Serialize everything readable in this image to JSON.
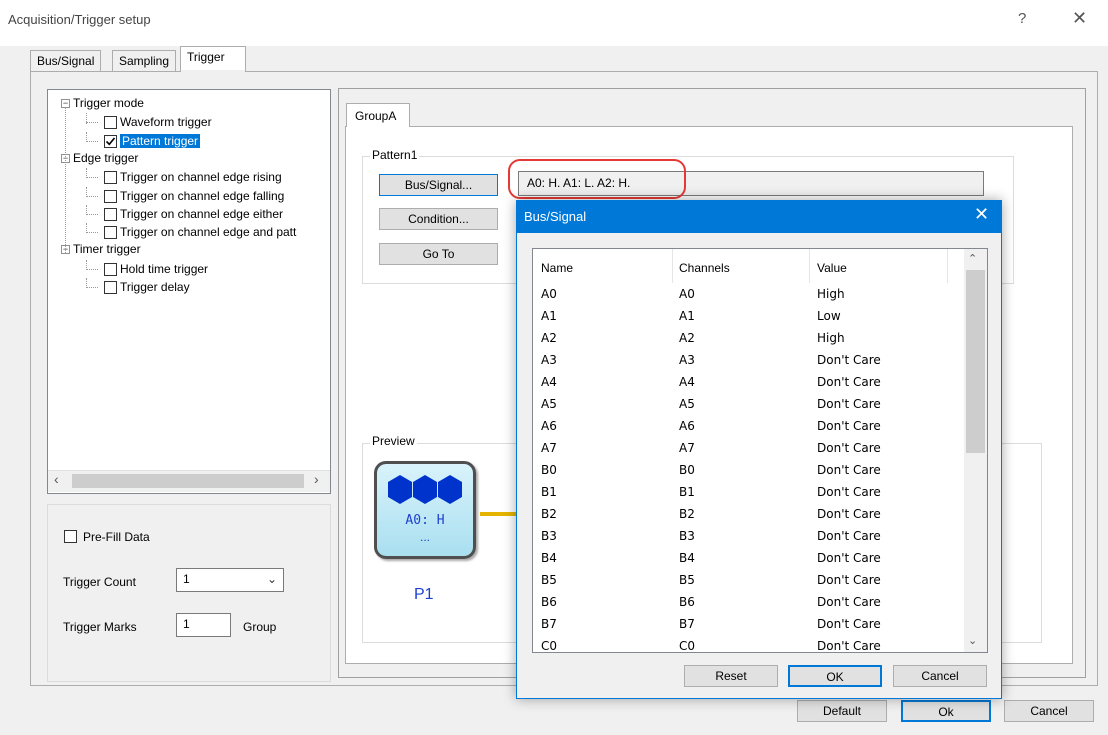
{
  "window": {
    "title": "Acquisition/Trigger setup",
    "help_glyph": "?",
    "close_glyph": "✕"
  },
  "tabs": [
    {
      "label": "Bus/Signal"
    },
    {
      "label": "Sampling"
    },
    {
      "label": "Trigger",
      "active": true
    }
  ],
  "tree": {
    "nodes": [
      {
        "label": "Trigger mode",
        "level": 0,
        "expander": "−"
      },
      {
        "label": "Waveform trigger",
        "level": 1,
        "checked": false
      },
      {
        "label": "Pattern trigger",
        "level": 1,
        "checked": true,
        "selected": true
      },
      {
        "label": "Edge trigger",
        "level": 0,
        "expander": "−"
      },
      {
        "label": "Trigger on channel edge rising",
        "level": 1,
        "checked": false
      },
      {
        "label": "Trigger on channel edge falling",
        "level": 1,
        "checked": false
      },
      {
        "label": "Trigger on channel edge either",
        "level": 1,
        "checked": false
      },
      {
        "label": "Trigger on channel edge and patt",
        "level": 1,
        "checked": false
      },
      {
        "label": "Timer trigger",
        "level": 0,
        "expander": "−"
      },
      {
        "label": "Hold time trigger",
        "level": 1,
        "checked": false
      },
      {
        "label": "Trigger delay",
        "level": 1,
        "checked": false
      }
    ],
    "scroll_left": "‹",
    "scroll_right": "›"
  },
  "settings": {
    "prefill_label": "Pre-Fill Data",
    "prefill_checked": false,
    "trigger_count_label": "Trigger Count",
    "trigger_count_value": "1",
    "trigger_marks_label": "Trigger Marks",
    "trigger_marks_value": "1",
    "trigger_marks_unit": "Group"
  },
  "group": {
    "tab_label": "GroupA",
    "pattern_legend": "Pattern1",
    "bus_signal_button": "Bus/Signal...",
    "condition_button": "Condition...",
    "goto_button": "Go To",
    "pattern_value": "A0: H. A1: L. A2: H.",
    "preview_legend": "Preview",
    "node_text": "A0: H",
    "node_dots": "...",
    "node_label": "P1",
    "accent_color": "#1d3fd0",
    "highlight_color": "#e53935"
  },
  "dialog": {
    "title": "Bus/Signal",
    "close_glyph": "✕",
    "columns": [
      "Name",
      "Channels",
      "Value"
    ],
    "rows": [
      [
        "A0",
        "A0",
        "High"
      ],
      [
        "A1",
        "A1",
        "Low"
      ],
      [
        "A2",
        "A2",
        "High"
      ],
      [
        "A3",
        "A3",
        "Don't Care"
      ],
      [
        "A4",
        "A4",
        "Don't Care"
      ],
      [
        "A5",
        "A5",
        "Don't Care"
      ],
      [
        "A6",
        "A6",
        "Don't Care"
      ],
      [
        "A7",
        "A7",
        "Don't Care"
      ],
      [
        "B0",
        "B0",
        "Don't Care"
      ],
      [
        "B1",
        "B1",
        "Don't Care"
      ],
      [
        "B2",
        "B2",
        "Don't Care"
      ],
      [
        "B3",
        "B3",
        "Don't Care"
      ],
      [
        "B4",
        "B4",
        "Don't Care"
      ],
      [
        "B5",
        "B5",
        "Don't Care"
      ],
      [
        "B6",
        "B6",
        "Don't Care"
      ],
      [
        "B7",
        "B7",
        "Don't Care"
      ],
      [
        "C0",
        "C0",
        "Don't Care"
      ]
    ],
    "reset_button": "Reset",
    "ok_button": "OK",
    "cancel_button": "Cancel",
    "scroll_up": "⌃",
    "scroll_down": "⌄"
  },
  "footer": {
    "default_button": "Default",
    "ok_button": "Ok",
    "cancel_button": "Cancel"
  }
}
